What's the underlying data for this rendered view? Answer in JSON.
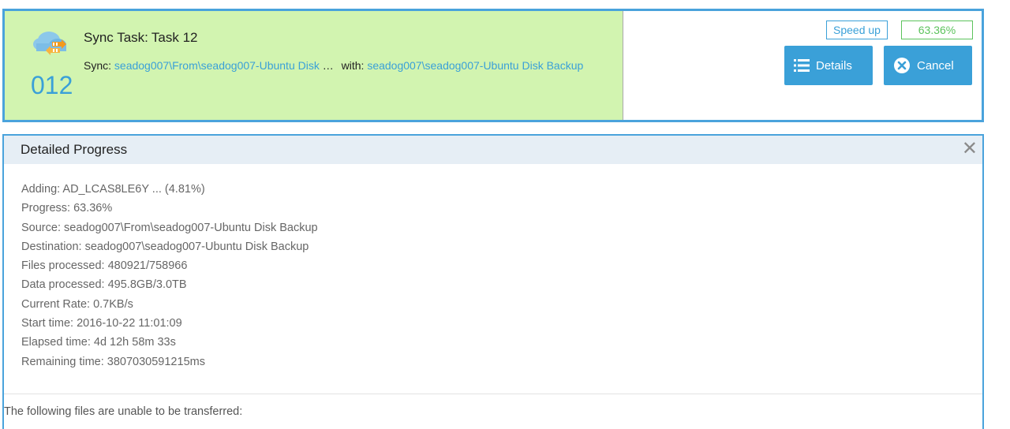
{
  "task": {
    "number": "012",
    "title_prefix": "Sync Task:",
    "title_value": "Task 12",
    "sync_label": "Sync:",
    "sync_source": "seadog007\\From\\seadog007-Ubuntu Disk",
    "sync_ellipsis": " …",
    "with_label": "with:",
    "sync_destination": "seadog007\\seadog007-Ubuntu Disk Backup",
    "progress": 0.6336,
    "speed_up_label": "Speed up",
    "percent_label": "63.36%",
    "details_label": "Details",
    "cancel_label": "Cancel",
    "icon": "cloud-sync-icon",
    "progress_color": "#d2f4b0",
    "accent_color": "#3aa0d8"
  },
  "panel": {
    "title": "Detailed Progress",
    "close_icon": "close-icon",
    "rows": [
      "Adding: AD_LCAS8LE6Y ... (4.81%)",
      "Progress: 63.36%",
      "Source: seadog007\\From\\seadog007-Ubuntu Disk Backup",
      "Destination: seadog007\\seadog007-Ubuntu Disk Backup",
      "Files processed: 480921/758966",
      "Data processed: 495.8GB/3.0TB",
      "Current Rate: 0.7KB/s",
      "Start time: 2016-10-22 11:01:09",
      "Elapsed time: 4d 12h 58m 33s",
      "Remaining time: 3807030591215ms"
    ],
    "failed_label": "The following files are unable to be transferred:"
  }
}
